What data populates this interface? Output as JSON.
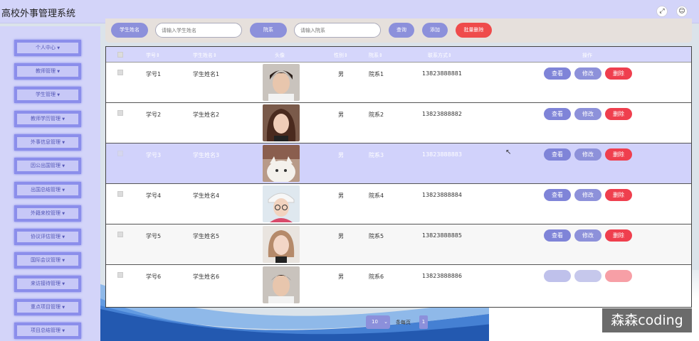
{
  "app": {
    "title": "高校外事管理系统",
    "fullscreen_icon": "fullscreen-icon",
    "user_icon": "user-icon"
  },
  "sidebar": {
    "items": [
      {
        "label": "个人中心"
      },
      {
        "label": "教师管理"
      },
      {
        "label": "学生管理"
      },
      {
        "label": "教师学历管理"
      },
      {
        "label": "外事信息管理"
      },
      {
        "label": "因公出国管理"
      },
      {
        "label": "出国总结管理"
      },
      {
        "label": "外籍来校管理"
      },
      {
        "label": "协议评估管理"
      },
      {
        "label": "国际会议管理"
      },
      {
        "label": "来访接待管理"
      },
      {
        "label": "重点项目管理"
      },
      {
        "label": "项目总结管理"
      }
    ]
  },
  "search": {
    "student_name_label": "学生姓名",
    "student_name_placeholder": "请输入学生姓名",
    "dept_label": "院系",
    "dept_placeholder": "请输入院系",
    "query_button": "查询",
    "add_button": "添加",
    "batch_delete_button": "批量删除"
  },
  "table": {
    "headers": [
      "学号",
      "学生姓名",
      "头像",
      "性别",
      "院系",
      "联系方式",
      "操作"
    ],
    "actions": {
      "view": "查看",
      "edit": "修改",
      "delete": "删除"
    },
    "rows": [
      {
        "id": "学号1",
        "name": "学生姓名1",
        "gender": "男",
        "dept": "院系1",
        "phone": "13823888881"
      },
      {
        "id": "学号2",
        "name": "学生姓名2",
        "gender": "男",
        "dept": "院系2",
        "phone": "13823888882"
      },
      {
        "id": "学号3",
        "name": "学生姓名3",
        "gender": "男",
        "dept": "院系3",
        "phone": "13823888883"
      },
      {
        "id": "学号4",
        "name": "学生姓名4",
        "gender": "男",
        "dept": "院系4",
        "phone": "13823888884"
      },
      {
        "id": "学号5",
        "name": "学生姓名5",
        "gender": "男",
        "dept": "院系5",
        "phone": "13823888885"
      },
      {
        "id": "学号6",
        "name": "学生姓名6",
        "gender": "男",
        "dept": "院系6",
        "phone": "13823888886"
      }
    ]
  },
  "pagination": {
    "page_size": "10",
    "per_page_label": "条每页",
    "current_page": "1"
  },
  "watermark": {
    "text": "森森coding"
  },
  "colors": {
    "accent": "#8c90db",
    "danger": "#ef3f4e",
    "header_bg": "#d3d4f9"
  }
}
